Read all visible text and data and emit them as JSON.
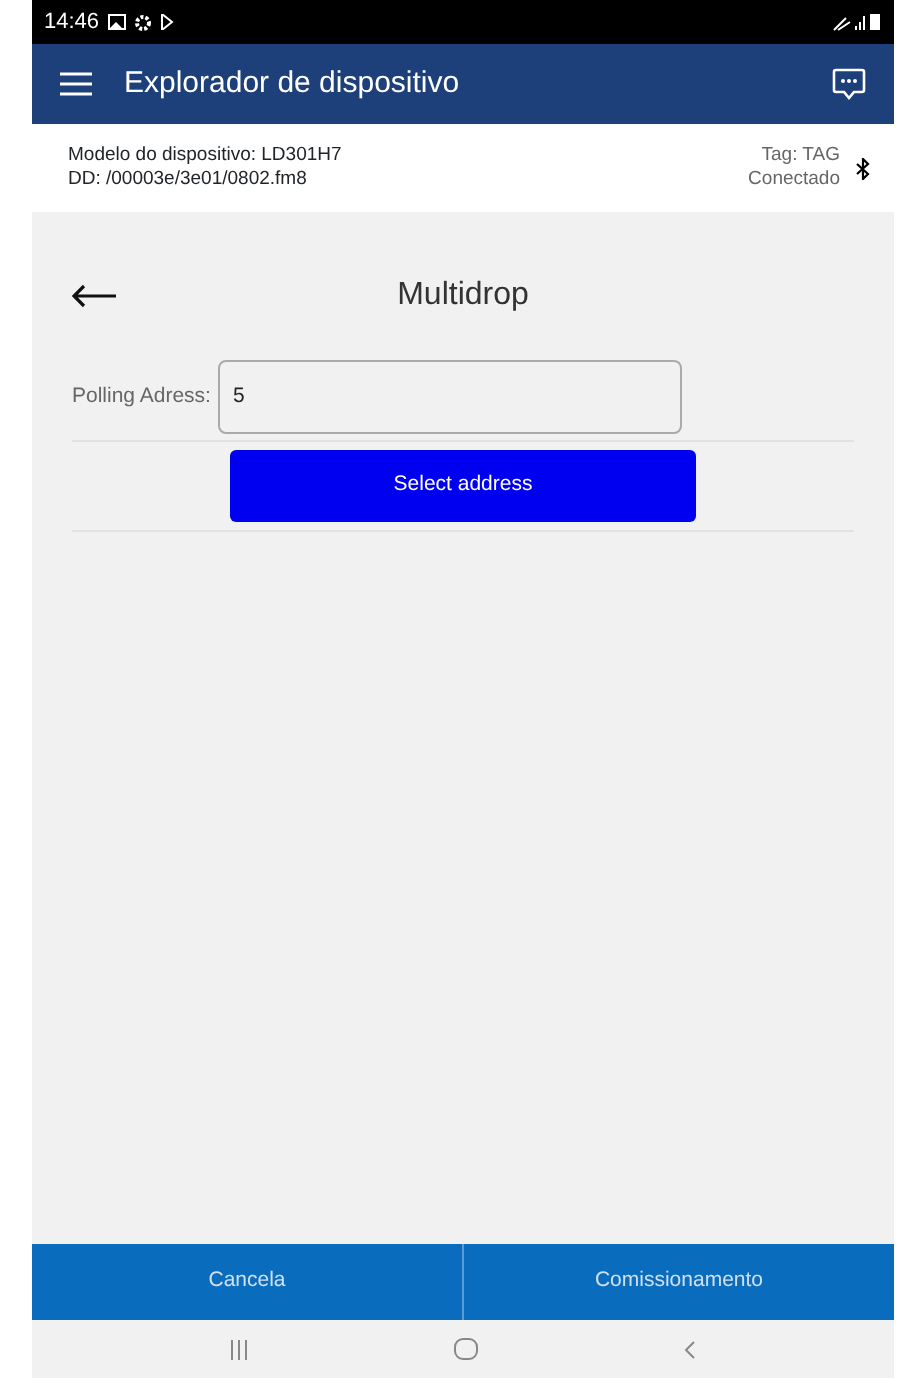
{
  "status_bar": {
    "time": "14:46"
  },
  "app_bar": {
    "title": "Explorador de dispositivo"
  },
  "device_info": {
    "model": "Modelo do dispositivo: LD301H7",
    "dd": "DD: /00003e/3e01/0802.fm8",
    "tag": "Tag: TAG",
    "connection": "Conectado"
  },
  "page": {
    "title": "Multidrop"
  },
  "form": {
    "label": "Polling Adress:",
    "value": "5",
    "button": "Select address"
  },
  "bottom_buttons": [
    "Cancela",
    "Comissionamento"
  ]
}
